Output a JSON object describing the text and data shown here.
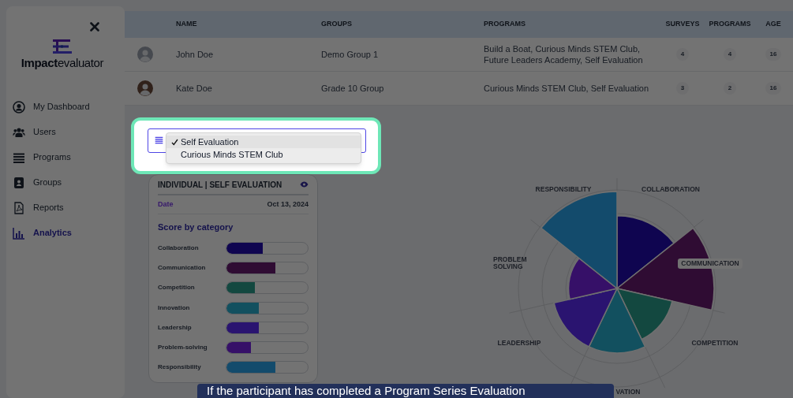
{
  "sidebar": {
    "logo_text": "**Impact**evaluator",
    "items": [
      {
        "label": "My Dashboard",
        "selected": false
      },
      {
        "label": "Users",
        "selected": false
      },
      {
        "label": "Programs",
        "selected": false
      },
      {
        "label": "Groups",
        "selected": false
      },
      {
        "label": "Reports",
        "selected": false
      },
      {
        "label": "Analytics",
        "selected": true
      }
    ]
  },
  "table": {
    "columns": [
      "NAME",
      "GROUPS",
      "PROGRAMS",
      "SURVEYS",
      "PROGRAMS",
      "AGE"
    ],
    "rows": [
      {
        "name": "John Doe",
        "group": "Demo Group 1",
        "programs": "Build a Boat, Curious Minds STEM Club, Future Leaders Academy, Self Evaluation",
        "surveys": "4",
        "program_count": "4",
        "age": "16"
      },
      {
        "name": "Kate Doe",
        "group": "Grade 10 Group",
        "programs": "Curious Minds STEM Club, Self Evaluation",
        "surveys": "3",
        "program_count": "2",
        "age": "16"
      }
    ]
  },
  "dropdown": {
    "options": [
      {
        "label": "Self Evaluation",
        "selected": true
      },
      {
        "label": "Curious Minds STEM Club",
        "selected": false
      }
    ]
  },
  "card": {
    "title": "INDIVIDUAL | SELF EVALUATION",
    "date_label": "Date",
    "date": "Oct 13, 2024",
    "section_title": "Score by category",
    "categories": [
      {
        "label": "Collaboration",
        "level": 0.45,
        "color": "#0f0550"
      },
      {
        "label": "Communication",
        "level": 0.6,
        "color": "#2f0c33"
      },
      {
        "label": "Competition",
        "level": 0.35,
        "color": "#134840"
      },
      {
        "label": "Innovation",
        "level": 0.4,
        "color": "#12505f"
      },
      {
        "label": "Leadership",
        "level": 0.4,
        "color": "#2a1470"
      },
      {
        "label": "Problem-solving",
        "level": 0.3,
        "color": "#361068"
      },
      {
        "label": "Responsibility",
        "level": 0.6,
        "color": "#134b6c"
      }
    ]
  },
  "polar_chart": {
    "labels": [
      "COLLABORATION",
      "COMMUNICATION",
      "COMPETITION",
      "VATION",
      "LEADERSHIP",
      "PROBLEM SOLVING",
      "RESPONSIBILITY"
    ]
  },
  "tooltip": {
    "text": "If the participant has completed a Program Series Evaluation"
  }
}
